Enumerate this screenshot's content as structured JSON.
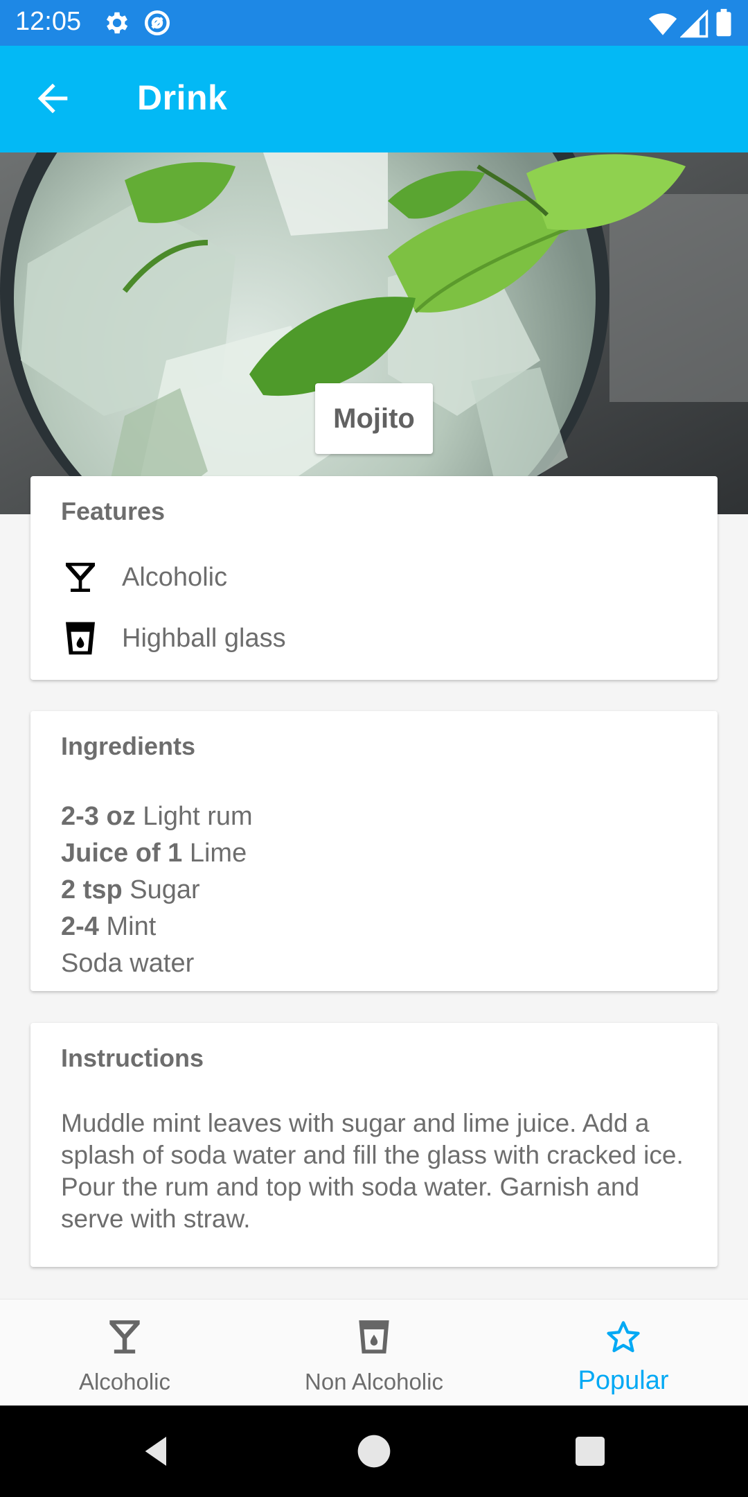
{
  "status_bar": {
    "time": "12:05",
    "icons": [
      "settings-gear-icon",
      "at-sign-icon",
      "wifi-icon",
      "signal-icon",
      "battery-icon"
    ]
  },
  "app_bar": {
    "title": "Drink",
    "back_icon": "arrow-back-icon"
  },
  "drink": {
    "name": "Mojito"
  },
  "features": {
    "title": "Features",
    "items": [
      {
        "icon": "cocktail-glass-icon",
        "label": "Alcoholic"
      },
      {
        "icon": "highball-glass-icon",
        "label": "Highball glass"
      }
    ]
  },
  "ingredients": {
    "title": "Ingredients",
    "items": [
      {
        "amount": "2-3 oz",
        "name": " Light rum"
      },
      {
        "amount": "Juice of 1",
        "name": " Lime"
      },
      {
        "amount": "2 tsp",
        "name": " Sugar"
      },
      {
        "amount": "2-4",
        "name": " Mint"
      },
      {
        "amount": "",
        "name": "Soda water"
      }
    ]
  },
  "instructions": {
    "title": "Instructions",
    "text": "Muddle mint leaves with sugar and lime juice. Add a splash of soda water and fill the glass with cracked ice. Pour the rum and top with soda water. Garnish and serve with straw."
  },
  "bottom_nav": {
    "items": [
      {
        "label": "Alcoholic",
        "icon": "cocktail-glass-icon",
        "active": false
      },
      {
        "label": "Non Alcoholic",
        "icon": "glass-icon",
        "active": false
      },
      {
        "label": "Popular",
        "icon": "star-outline-icon",
        "active": true
      }
    ]
  },
  "colors": {
    "status_bar": "#1e88e5",
    "app_bar": "#03b9f5",
    "accent": "#03a9f4",
    "text_secondary": "#6d6d6d"
  }
}
